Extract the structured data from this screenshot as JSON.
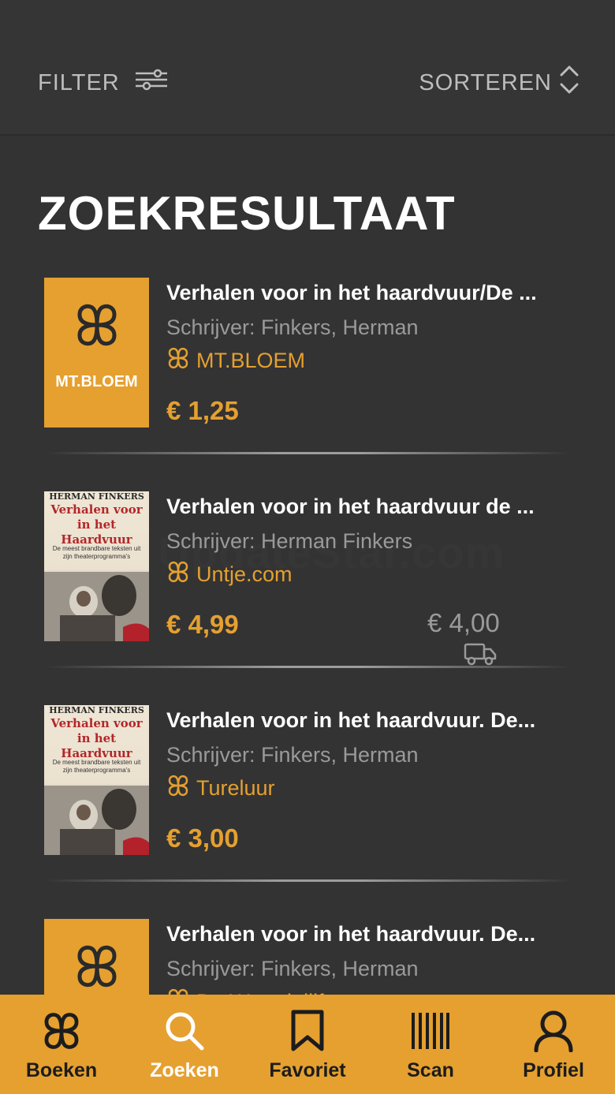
{
  "header": {
    "filter_label": "FILTER",
    "sort_label": "SORTEREN"
  },
  "page": {
    "title": "ZOEKRESULTAAT"
  },
  "results": [
    {
      "title": "Verhalen voor in het haardvuur/De ...",
      "author": "Schrijver: Finkers, Herman",
      "store": "MT.BLOEM",
      "price": "€ 1,25",
      "thumb_text": "MT.BLOEM",
      "thumb_type": "placeholder"
    },
    {
      "title": "Verhalen voor in het haardvuur de ...",
      "author": "Schrijver: Herman Finkers",
      "store": "Untje.com",
      "price": "€ 4,99",
      "shipping": "€ 4,00",
      "thumb_type": "cover"
    },
    {
      "title": "Verhalen voor in het haardvuur. De...",
      "author": "Schrijver: Finkers, Herman",
      "store": "Tureluur",
      "price": "€ 3,00",
      "thumb_type": "cover"
    },
    {
      "title": "Verhalen voor in het haardvuur. De...",
      "author": "Schrijver: Finkers, Herman",
      "store": "De Woordelijf",
      "thumb_type": "placeholder"
    }
  ],
  "cover_art": {
    "author": "HERMAN FINKERS",
    "title_line1": "Verhalen voor",
    "title_line2": "in het",
    "title_line3": "Haardvuur",
    "subtitle": "De meest brandbare teksten uit zijn theaterprogramma's"
  },
  "watermark": "UpdateStar.com",
  "nav": [
    {
      "label": "Boeken",
      "icon": "book-logo-icon",
      "active": false
    },
    {
      "label": "Zoeken",
      "icon": "search-icon",
      "active": true
    },
    {
      "label": "Favoriet",
      "icon": "bookmark-icon",
      "active": false
    },
    {
      "label": "Scan",
      "icon": "barcode-icon",
      "active": false
    },
    {
      "label": "Profiel",
      "icon": "user-icon",
      "active": false
    }
  ],
  "colors": {
    "accent": "#e5a030",
    "background": "#333333",
    "muted_text": "#9a9a9a"
  }
}
